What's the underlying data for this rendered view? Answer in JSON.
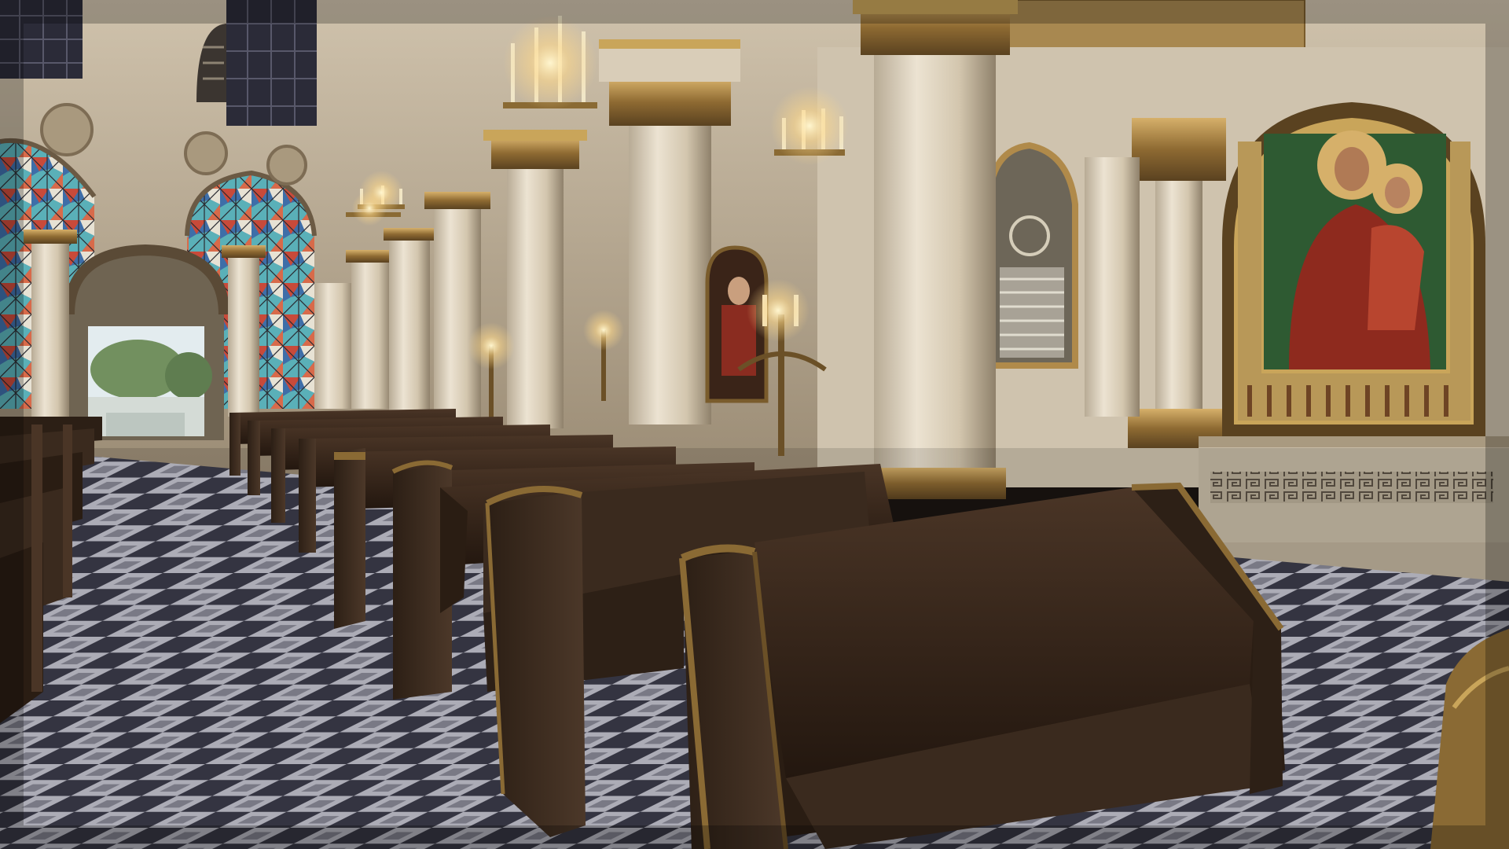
{
  "scene": {
    "title": "",
    "description_hidden": true,
    "colors": {
      "marble": "#d9cdb8",
      "marble_shadow": "#9c8e78",
      "gold": "#b08a4a",
      "gold_dark": "#6b5027",
      "wood": "#3e2c20",
      "wood_dark": "#22170f",
      "wood_light": "#5a4030",
      "floor_light": "#bfbfcb",
      "floor_dark": "#3a3a48",
      "window_red": "#c84a3a",
      "window_blue": "#3e6ea8",
      "window_teal": "#5ab0b8",
      "icon_red": "#8e2a1e",
      "icon_green": "#2e5a32",
      "icon_gold": "#c9a55a",
      "candle_glow": "#fff1c0",
      "outside_green": "#7a9a6a",
      "outside_sky": "#e6eef0"
    }
  }
}
